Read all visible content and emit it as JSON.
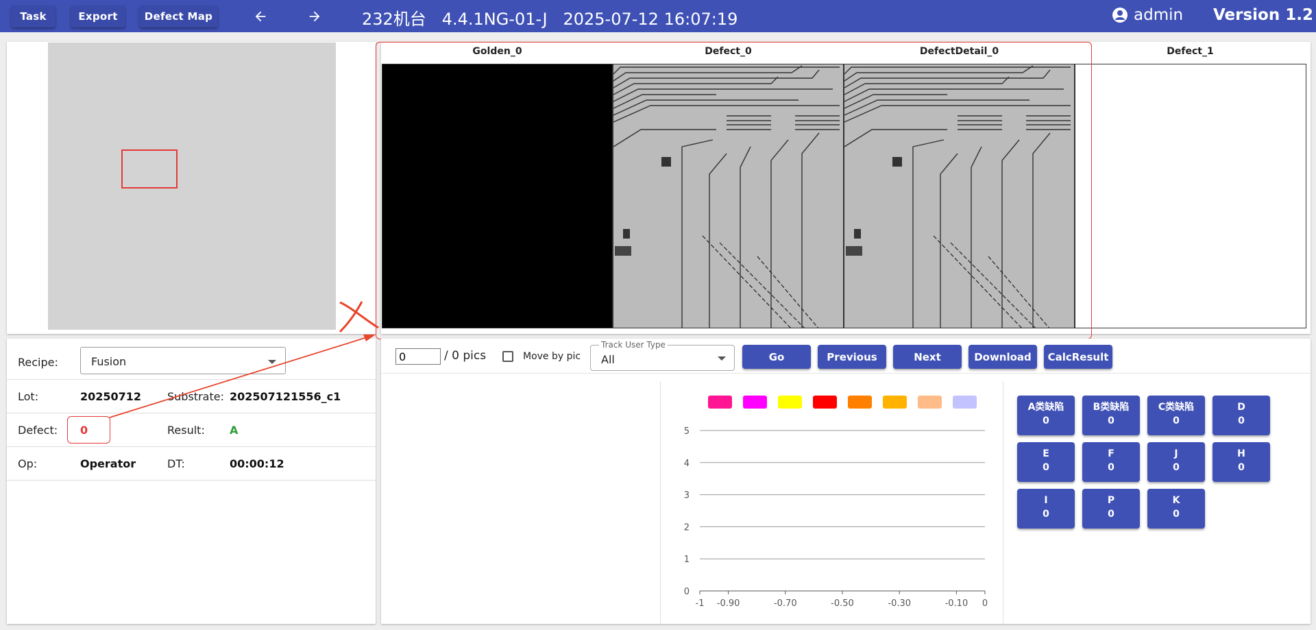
{
  "toolbar": {
    "task": "Task",
    "export": "Export",
    "defect_map": "Defect Map",
    "back_icon": "arrow-left-icon",
    "forward_icon": "arrow-right-icon"
  },
  "header": {
    "title": "232机台   4.4.1NG-01-J   2025-07-12 16:07:19",
    "user": "admin",
    "user_icon": "account-circle-icon",
    "version": "Version 1.2"
  },
  "images": [
    {
      "title": "Golden_0"
    },
    {
      "title": "Defect_0"
    },
    {
      "title": "DefectDetail_0"
    },
    {
      "title": "Defect_1"
    }
  ],
  "info": {
    "recipe_label": "Recipe:",
    "recipe_value": "Fusion",
    "lot_label": "Lot:",
    "lot_value": "20250712",
    "substrate_label": "Substrate:",
    "substrate_value": "202507121556_c1",
    "defect_label": "Defect:",
    "defect_value": "0",
    "result_label": "Result:",
    "result_value": "A",
    "op_label": "Op:",
    "op_value": "Operator",
    "dt_label": "DT:",
    "dt_value": "00:00:12"
  },
  "controls": {
    "page_value": "0",
    "pics_text": "/ 0 pics",
    "move_by_pic": "Move by pic",
    "track_label": "Track User Type",
    "track_value": "All",
    "go": "Go",
    "previous": "Previous",
    "next": "Next",
    "download": "Download",
    "calc": "CalcResult"
  },
  "colors": {
    "primary": "#3f51b5",
    "highlight": "#e53935",
    "result_ok": "#2e9d3a"
  },
  "chart_data": {
    "type": "bar",
    "legend_colors": [
      "#ff1493",
      "#ff00ff",
      "#ffff00",
      "#ff0000",
      "#ff7f00",
      "#ffb300",
      "#ffbb88",
      "#c3c3ff"
    ],
    "series": [],
    "ylim": [
      0,
      5
    ],
    "yticks": [
      "0",
      "1",
      "2",
      "3",
      "4",
      "5"
    ],
    "xlim": [
      -1,
      0
    ],
    "xticks": [
      "-1",
      "-0.90",
      "-0.70",
      "-0.50",
      "-0.30",
      "-0.10",
      "0"
    ],
    "grid": true
  },
  "categories": [
    {
      "name": "A类缺陷",
      "count": "0"
    },
    {
      "name": "B类缺陷",
      "count": "0"
    },
    {
      "name": "C类缺陷",
      "count": "0"
    },
    {
      "name": "D",
      "count": "0"
    },
    {
      "name": "E",
      "count": "0"
    },
    {
      "name": "F",
      "count": "0"
    },
    {
      "name": "J",
      "count": "0"
    },
    {
      "name": "H",
      "count": "0"
    },
    {
      "name": "I",
      "count": "0"
    },
    {
      "name": "P",
      "count": "0"
    },
    {
      "name": "K",
      "count": "0"
    }
  ]
}
